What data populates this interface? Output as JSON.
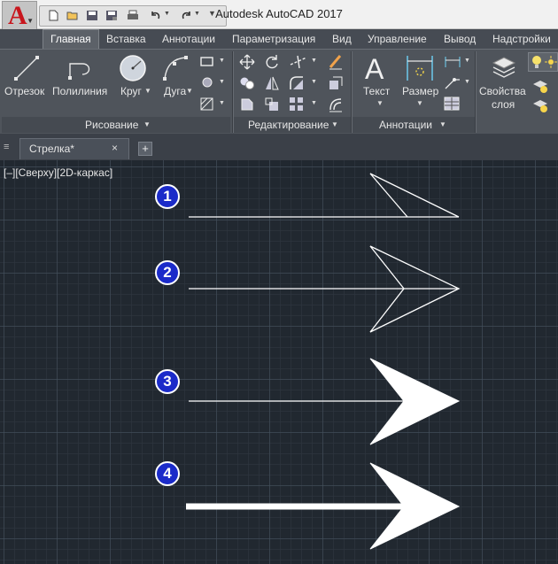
{
  "app": {
    "title": "Autodesk AutoCAD 2017",
    "logo_letter": "A"
  },
  "ribbon_tabs": [
    {
      "label": "Главная",
      "active": true
    },
    {
      "label": "Вставка"
    },
    {
      "label": "Аннотации"
    },
    {
      "label": "Параметризация"
    },
    {
      "label": "Вид"
    },
    {
      "label": "Управление"
    },
    {
      "label": "Вывод"
    },
    {
      "label": "Надстройки"
    }
  ],
  "panels": {
    "draw": {
      "title": "Рисование",
      "tools": [
        "Отрезок",
        "Полилиния",
        "Круг",
        "Дуга"
      ]
    },
    "modify": {
      "title": "Редактирование"
    },
    "annotation": {
      "title": "Аннотации",
      "tools": [
        "Текст",
        "Размер"
      ]
    },
    "layers": {
      "tool_line1": "Свойства",
      "tool_line2": "слоя"
    }
  },
  "file_tab": {
    "label": "Стрелка*",
    "close": "×",
    "new_tab": "+"
  },
  "viewport": {
    "label": "[–][Сверху][2D-каркас]"
  },
  "drawing": {
    "badges": [
      "1",
      "2",
      "3",
      "4"
    ]
  },
  "colors": {
    "badge": "#1b2bc9",
    "canvas": "#212830",
    "ribbon": "#4f545b",
    "logo_red": "#c8161d"
  }
}
